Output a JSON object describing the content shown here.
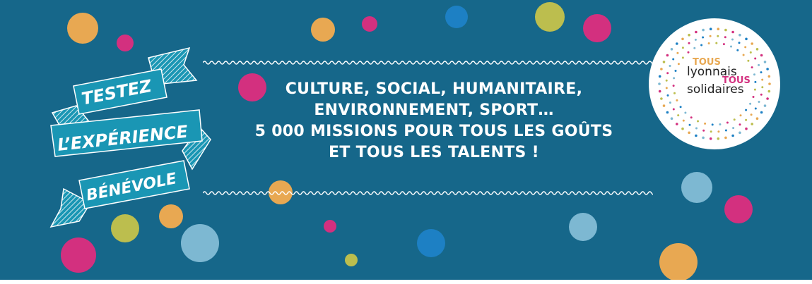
{
  "ribbon": {
    "line1": "TESTEZ",
    "line2": "L’EXPÉRIENCE",
    "line3": "BÉNÉVOLE"
  },
  "message": {
    "lines": [
      "CULTURE, SOCIAL, HUMANITAIRE,",
      "ENVIRONNEMENT, SPORT…",
      "5 000 MISSIONS POUR TOUS LES GOÛTS",
      "ET TOUS LES TALENTS !"
    ]
  },
  "logo": {
    "word1": "TOUS",
    "word2": "lyonnais",
    "word3": "TOUS",
    "word4": "solidaires"
  },
  "colors": {
    "background": "#16678a",
    "ribbon": "#1a96b4",
    "orange": "#e8a852",
    "magenta": "#d3307f",
    "lime": "#bcbe4e",
    "light_blue": "#7db8d2",
    "blue": "#1d80c4"
  }
}
